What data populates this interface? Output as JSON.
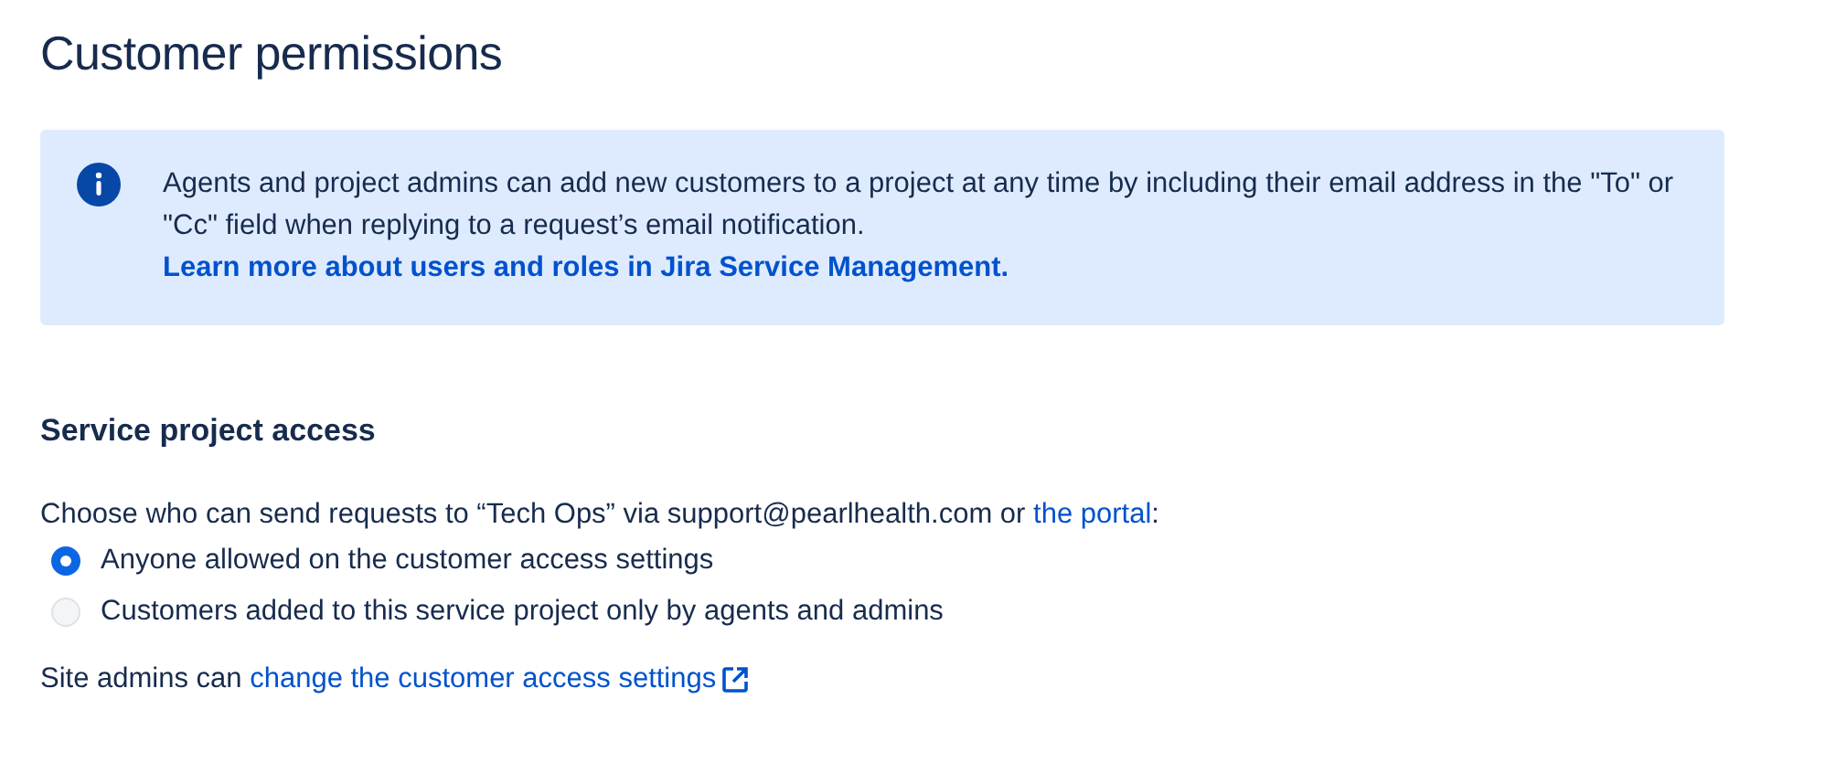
{
  "title": "Customer permissions",
  "info": {
    "text": "Agents and project admins can add new customers to a project at any time by including their email address in the \"To\" or \"Cc\" field when replying to a request’s email notification.",
    "link": "Learn more about users and roles in Jira Service Management."
  },
  "section": {
    "heading": "Service project access",
    "prompt": "Choose who can send requests to “Tech Ops” via support@pearlhealth.com or ",
    "prompt_link": "the portal",
    "prompt_end": ":",
    "options": [
      {
        "label": "Anyone allowed on the customer access settings",
        "selected": true
      },
      {
        "label": "Customers added to this service project only by agents and admins",
        "selected": false
      }
    ],
    "footer": "Site admins can ",
    "footer_link": "change the customer access settings"
  }
}
